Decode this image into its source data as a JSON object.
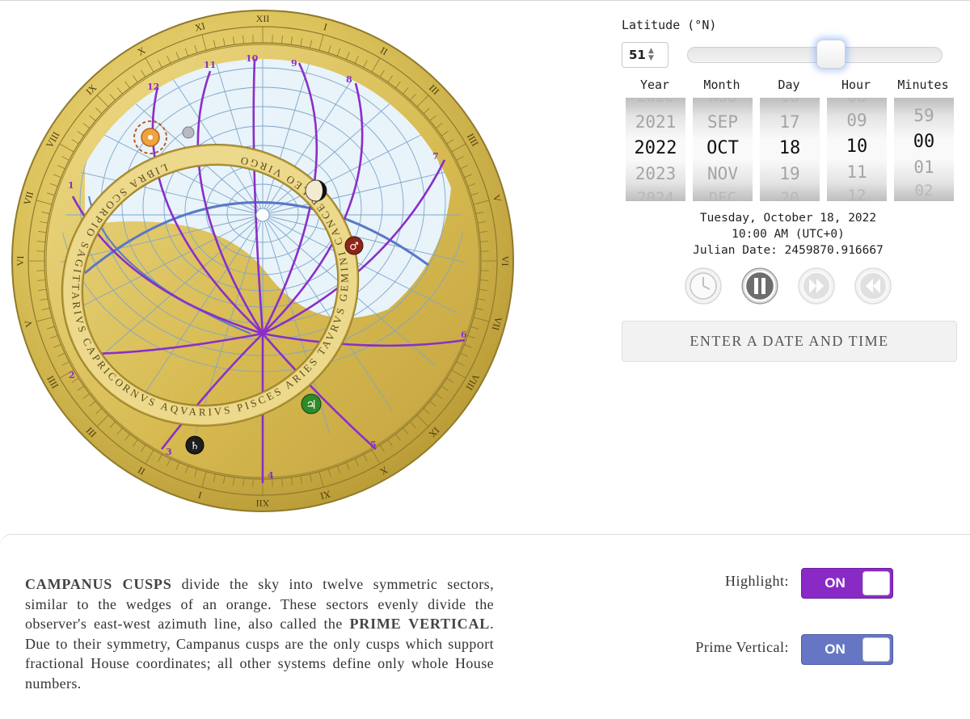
{
  "astrolabe": {
    "hour_numerals": [
      "XII",
      "I",
      "II",
      "III",
      "IIII",
      "V",
      "VI",
      "VII",
      "VIII",
      "IX",
      "X",
      "XI",
      "XII",
      "I",
      "II",
      "III",
      "IIII",
      "V",
      "VI",
      "VII",
      "VIII",
      "IX",
      "X",
      "XI"
    ],
    "house_numbers": [
      "1",
      "2",
      "3",
      "4",
      "5",
      "6",
      "7",
      "8",
      "9",
      "10",
      "11",
      "12"
    ],
    "zodiac_text": "LIBRA SCORPIO SAGITTARIVS CAPRICORNVS AQVARIVS PISCES ARIES TAVRVS GEMINI CANCER LEO VIRGO",
    "colors": {
      "gold": "#d9bd55",
      "sky": "#e8f3fa",
      "house_lines": "#8a2fc8",
      "horizon": "#5b78c4"
    },
    "planets": [
      "sun-icon",
      "mercury-icon",
      "moon-icon",
      "mars-icon",
      "jupiter-icon",
      "saturn-icon"
    ]
  },
  "latitude": {
    "label": "Latitude (°N)",
    "value": "51",
    "slider_fraction": 0.567
  },
  "pickers": {
    "year": {
      "header": "Year",
      "items": [
        "2020",
        "2021",
        "2022",
        "2023",
        "2024"
      ]
    },
    "month": {
      "header": "Month",
      "items": [
        "AUG",
        "SEP",
        "OCT",
        "NOV",
        "DEC"
      ]
    },
    "day": {
      "header": "Day",
      "items": [
        "16",
        "17",
        "18",
        "19",
        "20"
      ]
    },
    "hour": {
      "header": "Hour",
      "items": [
        "08",
        "09",
        "10",
        "11",
        "12"
      ]
    },
    "minutes": {
      "header": "Minutes",
      "items": [
        "58",
        "59",
        "00",
        "01",
        "02"
      ]
    }
  },
  "datetime": {
    "line1": "Tuesday, October 18, 2022",
    "line2": "10:00 AM (UTC+0)",
    "line3": "Julian Date: 2459870.916667"
  },
  "controls": {
    "icons": [
      "clock-icon",
      "pause-icon",
      "fast-forward-icon",
      "rewind-icon"
    ]
  },
  "enter_button": "ENTER A DATE AND TIME",
  "description": {
    "term1": "CAMPANUS CUSPS",
    "text1": " divide the sky into twelve symmetric sectors, similar to the wedges of an orange. These sectors evenly divide the observer's east-west azimuth line, also called the ",
    "term2": "PRIME VERTICAL",
    "text2": ". Due to their symmetry, Campanus cusps are the only cusps which support fractional House coordinates; all other systems define only whole House numbers."
  },
  "toggles": {
    "highlight": {
      "label": "Highlight:",
      "state": "ON",
      "color": "#8a2ac6"
    },
    "prime_vertical": {
      "label": "Prime Vertical:",
      "state": "ON",
      "color": "#6676c4"
    }
  }
}
